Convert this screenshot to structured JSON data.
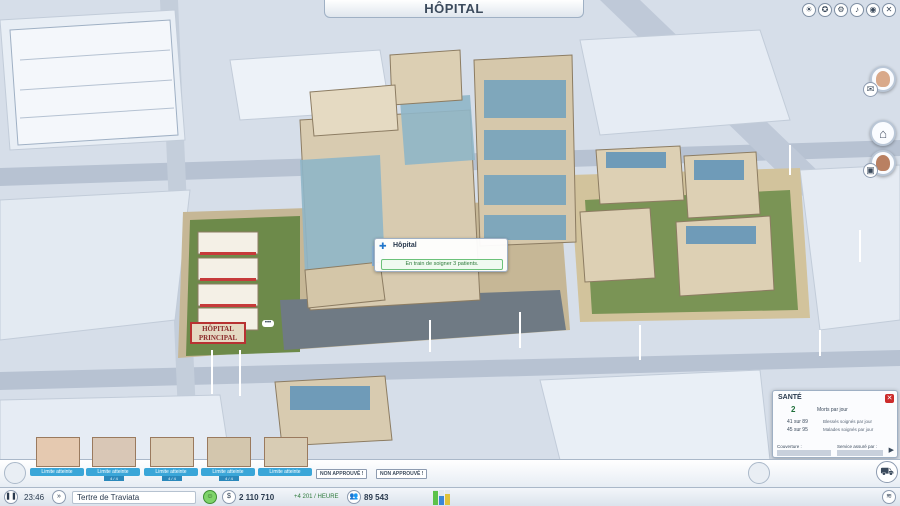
{
  "window": {
    "title": "HÔPITAL"
  },
  "sys_icons": [
    "sun-icon",
    "medal-icon",
    "gear-icon",
    "sound-icon",
    "globe-icon",
    "close-icon"
  ],
  "sys_glyphs": [
    "☀",
    "✪",
    "⚙",
    "♪",
    "◉",
    "✕"
  ],
  "tooltip": {
    "title": "Hôpital",
    "message": "En train de soigner 3 patients."
  },
  "sign": {
    "text": "HÔPITAL PRINCIPAL"
  },
  "sante": {
    "title": "SANTÉ",
    "deaths_value": "2",
    "deaths_label": "Morts par jour",
    "rows": [
      {
        "value": "41 sur 89",
        "label": "Blessés soignés par jour"
      },
      {
        "value": "45 sur 95",
        "label": "Malades soignés par jour"
      }
    ],
    "coverage_label": "Couverture :",
    "insured_label": "Service assuré par :"
  },
  "palette": {
    "items": [
      {
        "label": "Limite atteinte",
        "sub": ""
      },
      {
        "label": "Limite atteinte",
        "sub": "4 / 4"
      },
      {
        "label": "Limite atteinte",
        "sub": "4 / 4"
      },
      {
        "label": "Limite atteinte",
        "sub": "4 / 4"
      },
      {
        "label": "Limite atteinte",
        "sub": ""
      }
    ],
    "not_approved": [
      "NON APPROUVÉ !",
      "NON APPROUVÉ !"
    ]
  },
  "status": {
    "time": "23:46",
    "city_name": "Tertre de Traviata",
    "funds": "2 110 710",
    "income": "+4 201 / HEURE",
    "population": "89 543",
    "rci_levels": {
      "residential": 0.9,
      "commercial": 0.6,
      "industrial": 0.75
    }
  },
  "colors": {
    "accent": "#3aa6d8",
    "positive": "#2e7a3b",
    "close": "#cc2b2b",
    "residential": "#5cc24a",
    "commercial": "#3a86d8",
    "industrial": "#e0c23a"
  }
}
